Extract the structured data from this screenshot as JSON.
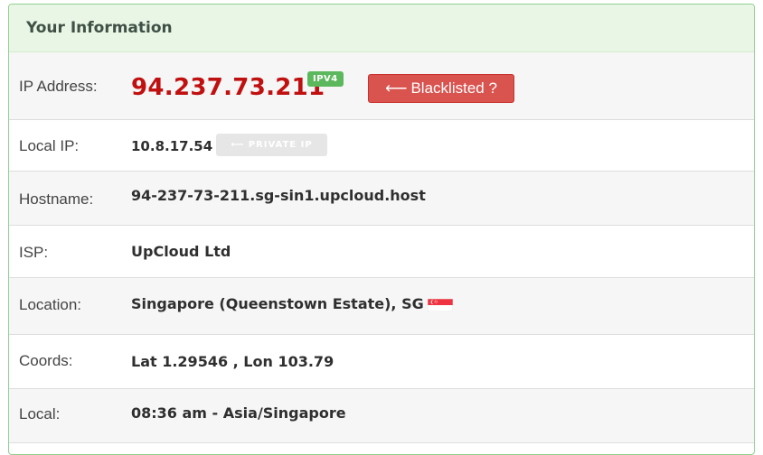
{
  "panel": {
    "title": "Your Information"
  },
  "rows": {
    "ip": {
      "label": "IP Address:",
      "value": "94.237.73.211",
      "badge": "IPV4",
      "button_arrow": "⟵",
      "button_label": "Blacklisted ?"
    },
    "local_ip": {
      "label": "Local IP:",
      "value": "10.8.17.54",
      "button_arrow": "⟵",
      "button_label": "PRIVATE IP"
    },
    "hostname": {
      "label": "Hostname:",
      "value": "94-237-73-211.sg-sin1.upcloud.host"
    },
    "isp": {
      "label": "ISP:",
      "value": "UpCloud Ltd"
    },
    "location": {
      "label": "Location:",
      "value": "Singapore (Queenstown Estate), SG ⟵",
      "flag_icon": "singapore-flag-icon"
    },
    "coords": {
      "label": "Coords:",
      "value": "Lat 1.29546 , Lon 103.79"
    },
    "local": {
      "label": "Local:",
      "value": "08:36 am - Asia/Singapore"
    }
  },
  "colors": {
    "accent_green": "#5cb85c",
    "danger_red": "#d9534f",
    "ip_red": "#c01010",
    "header_bg": "#e9f6e6"
  }
}
